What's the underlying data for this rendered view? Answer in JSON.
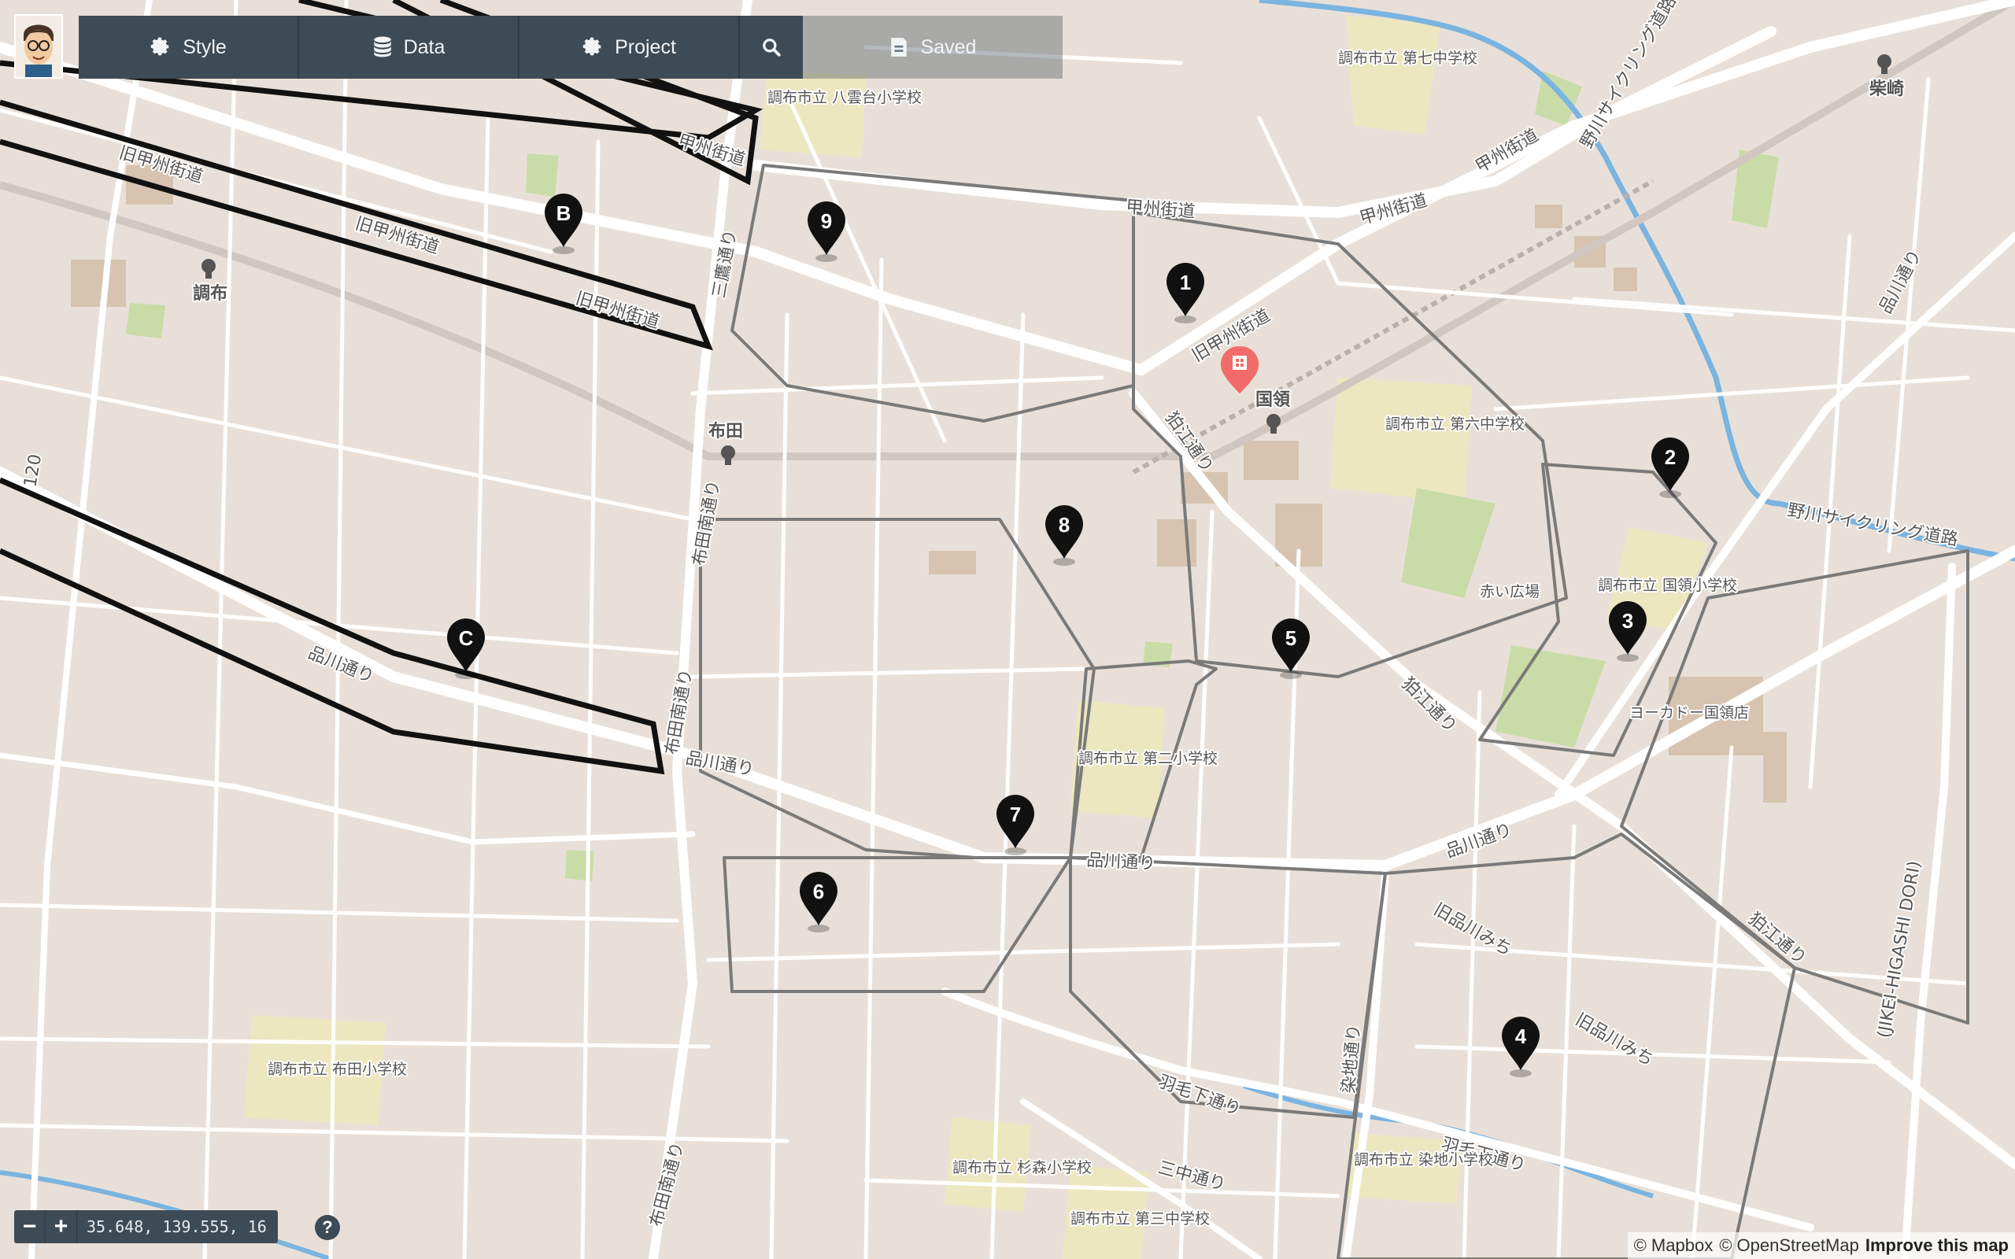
{
  "toolbar": {
    "style_label": "Style",
    "data_label": "Data",
    "project_label": "Project",
    "saved_label": "Saved",
    "style_icon": "gear-icon",
    "data_icon": "database-icon",
    "project_icon": "gear-icon",
    "search_icon": "search-icon",
    "saved_icon": "save-icon"
  },
  "map": {
    "markers_numbered": [
      "1",
      "2",
      "3",
      "4",
      "5",
      "6",
      "7",
      "8",
      "9"
    ],
    "markers_lettered": [
      "B",
      "C"
    ],
    "place_labels": {
      "chofu": "調布",
      "fuda": "布田",
      "kokuryo": "国領",
      "shibasaki": "柴崎",
      "koshu_kaido": "甲州街道",
      "kyu_koshu_kaido": "旧甲州街道",
      "shinagawa_dori": "品川通り",
      "komae_dori": "狛江通り",
      "mitaka_dori": "三鷹通り",
      "fuda_minami_dori": "布田南通り",
      "hanemoshita_dori": "羽毛下通り",
      "kyu_shinagawa_michi": "旧品川みち",
      "shirahata_dori": "染地通り",
      "nogawa_cycling": "野川サイクリング道路",
      "sannaka_dori": "三中通り",
      "akai_hiroba": "赤い広場",
      "ito_yokado": "ヨーカドー国領店",
      "jikei_higashi": "(JIKEI-HIGASHI DORI)",
      "school_7": "調布市立 第七中学校",
      "school_6": "調布市立 第六中学校",
      "school_kokuryo": "調布市立 国領小学校",
      "school_2": "調布市立 第二小学校",
      "school_yakumodai": "調布市立 八雲台小学校",
      "school_fuda": "調布市立 布田小学校",
      "school_sugimori": "調布市立 杉森小学校",
      "school_3": "調布市立 第三中学校",
      "school_somechi": "調布市立 染地小学校",
      "route_120": "120",
      "koka_dori": "柴崎"
    }
  },
  "coordinates": {
    "readout": "35.648, 139.555, 16",
    "zoom_out": "−",
    "zoom_in": "+",
    "help": "?"
  },
  "attribution": {
    "mapbox": "© Mapbox",
    "osm": "© OpenStreetMap",
    "improve": "Improve this map"
  }
}
